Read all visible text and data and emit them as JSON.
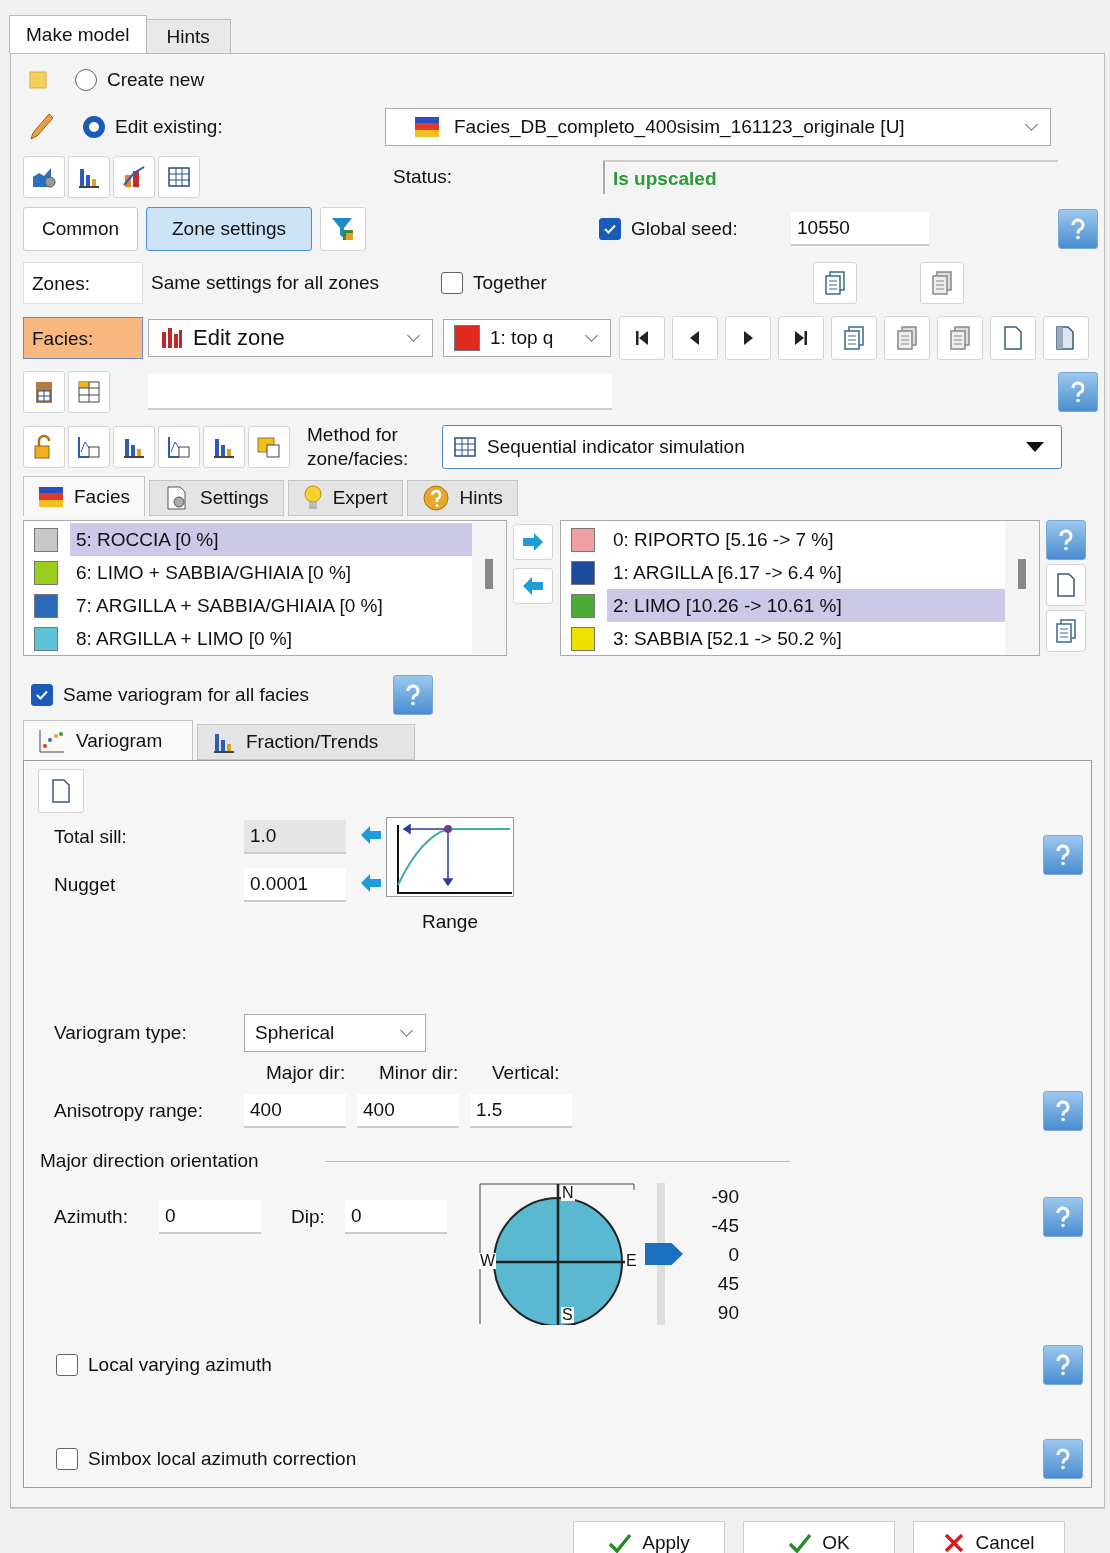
{
  "tabs": [
    {
      "label": "Make model",
      "selected": true
    },
    {
      "label": "Hints",
      "selected": false
    }
  ],
  "mode_options": [
    {
      "label": "Create new",
      "selected": false
    },
    {
      "label": "Edit existing:",
      "selected": true
    }
  ],
  "model_dropdown": {
    "value": "Facies_DB_completo_400sisim_161123_originale [U]"
  },
  "status": {
    "label": "Status:",
    "value": "Is upscaled"
  },
  "settings_tabs": [
    {
      "label": "Common",
      "selected": false
    },
    {
      "label": "Zone settings",
      "selected": true
    }
  ],
  "global_seed": {
    "label": "Global seed:",
    "checked": true,
    "value": "10550"
  },
  "zones": {
    "label": "Zones:",
    "text": "Same settings for all zones",
    "together_label": "Together",
    "together_checked": false
  },
  "facies_row": {
    "label": "Facies:",
    "zone_mode": "Edit zone",
    "zone": "1: top q"
  },
  "method": {
    "label": "Method for zone/facies:",
    "value": "Sequential indicator simulation"
  },
  "facies_tabs": [
    {
      "label": "Facies",
      "selected": true
    },
    {
      "label": "Settings",
      "selected": false
    },
    {
      "label": "Expert",
      "selected": false
    },
    {
      "label": "Hints",
      "selected": false
    }
  ],
  "available_facies": [
    {
      "label": "5: ROCCIA [0 %]",
      "color": "#c8c8c8",
      "selected": true
    },
    {
      "label": "6: LIMO + SABBIA/GHIAIA [0 %]",
      "color": "#9ccc1c",
      "selected": false
    },
    {
      "label": "7: ARGILLA + SABBIA/GHIAIA [0 %]",
      "color": "#2a6ab8",
      "selected": false
    },
    {
      "label": "8: ARGILLA + LIMO [0 %]",
      "color": "#5cc4d8",
      "selected": false
    }
  ],
  "used_facies": [
    {
      "label": "0: RIPORTO [5.16 -> 7 %]",
      "color": "#f0a0a0",
      "selected": false
    },
    {
      "label": "1: ARGILLA [6.17 -> 6.4 %]",
      "color": "#1c4c9c",
      "selected": false
    },
    {
      "label": "2: LIMO [10.26 -> 10.61 %]",
      "color": "#4caa34",
      "selected": true
    },
    {
      "label": "3: SABBIA [52.1 -> 50.2 %]",
      "color": "#f0e000",
      "selected": false
    }
  ],
  "same_variogram": {
    "label": "Same variogram for all facies",
    "checked": true
  },
  "variogram_tabs": [
    {
      "label": "Variogram",
      "selected": true
    },
    {
      "label": "Fraction/Trends",
      "selected": false
    }
  ],
  "total_sill": {
    "label": "Total sill:",
    "value": "1.0",
    "disabled": true
  },
  "nugget": {
    "label": "Nugget",
    "value": "0.0001",
    "disabled": false
  },
  "range_label": "Range",
  "variogram_type": {
    "label": "Variogram type:",
    "value": "Spherical"
  },
  "anisotropy": {
    "label": "Anisotropy range:",
    "columns": [
      "Major dir:",
      "Minor dir:",
      "Vertical:"
    ],
    "values": [
      "400",
      "400",
      "1.5"
    ]
  },
  "orientation": {
    "title": "Major direction orientation",
    "azimuth_label": "Azimuth:",
    "azimuth": "0",
    "dip_label": "Dip:",
    "dip": "0",
    "compass": [
      "N",
      "W",
      "E",
      "S"
    ],
    "scale": [
      "-90",
      "-45",
      "0",
      "45",
      "90"
    ],
    "level": 0.5
  },
  "options": [
    {
      "label": "Local varying azimuth",
      "checked": false
    },
    {
      "label": "Simbox local azimuth correction",
      "checked": false
    }
  ],
  "buttons": [
    {
      "label": "Apply",
      "kind": "apply"
    },
    {
      "label": "OK",
      "kind": "ok"
    },
    {
      "label": "Cancel",
      "kind": "cancel"
    }
  ]
}
